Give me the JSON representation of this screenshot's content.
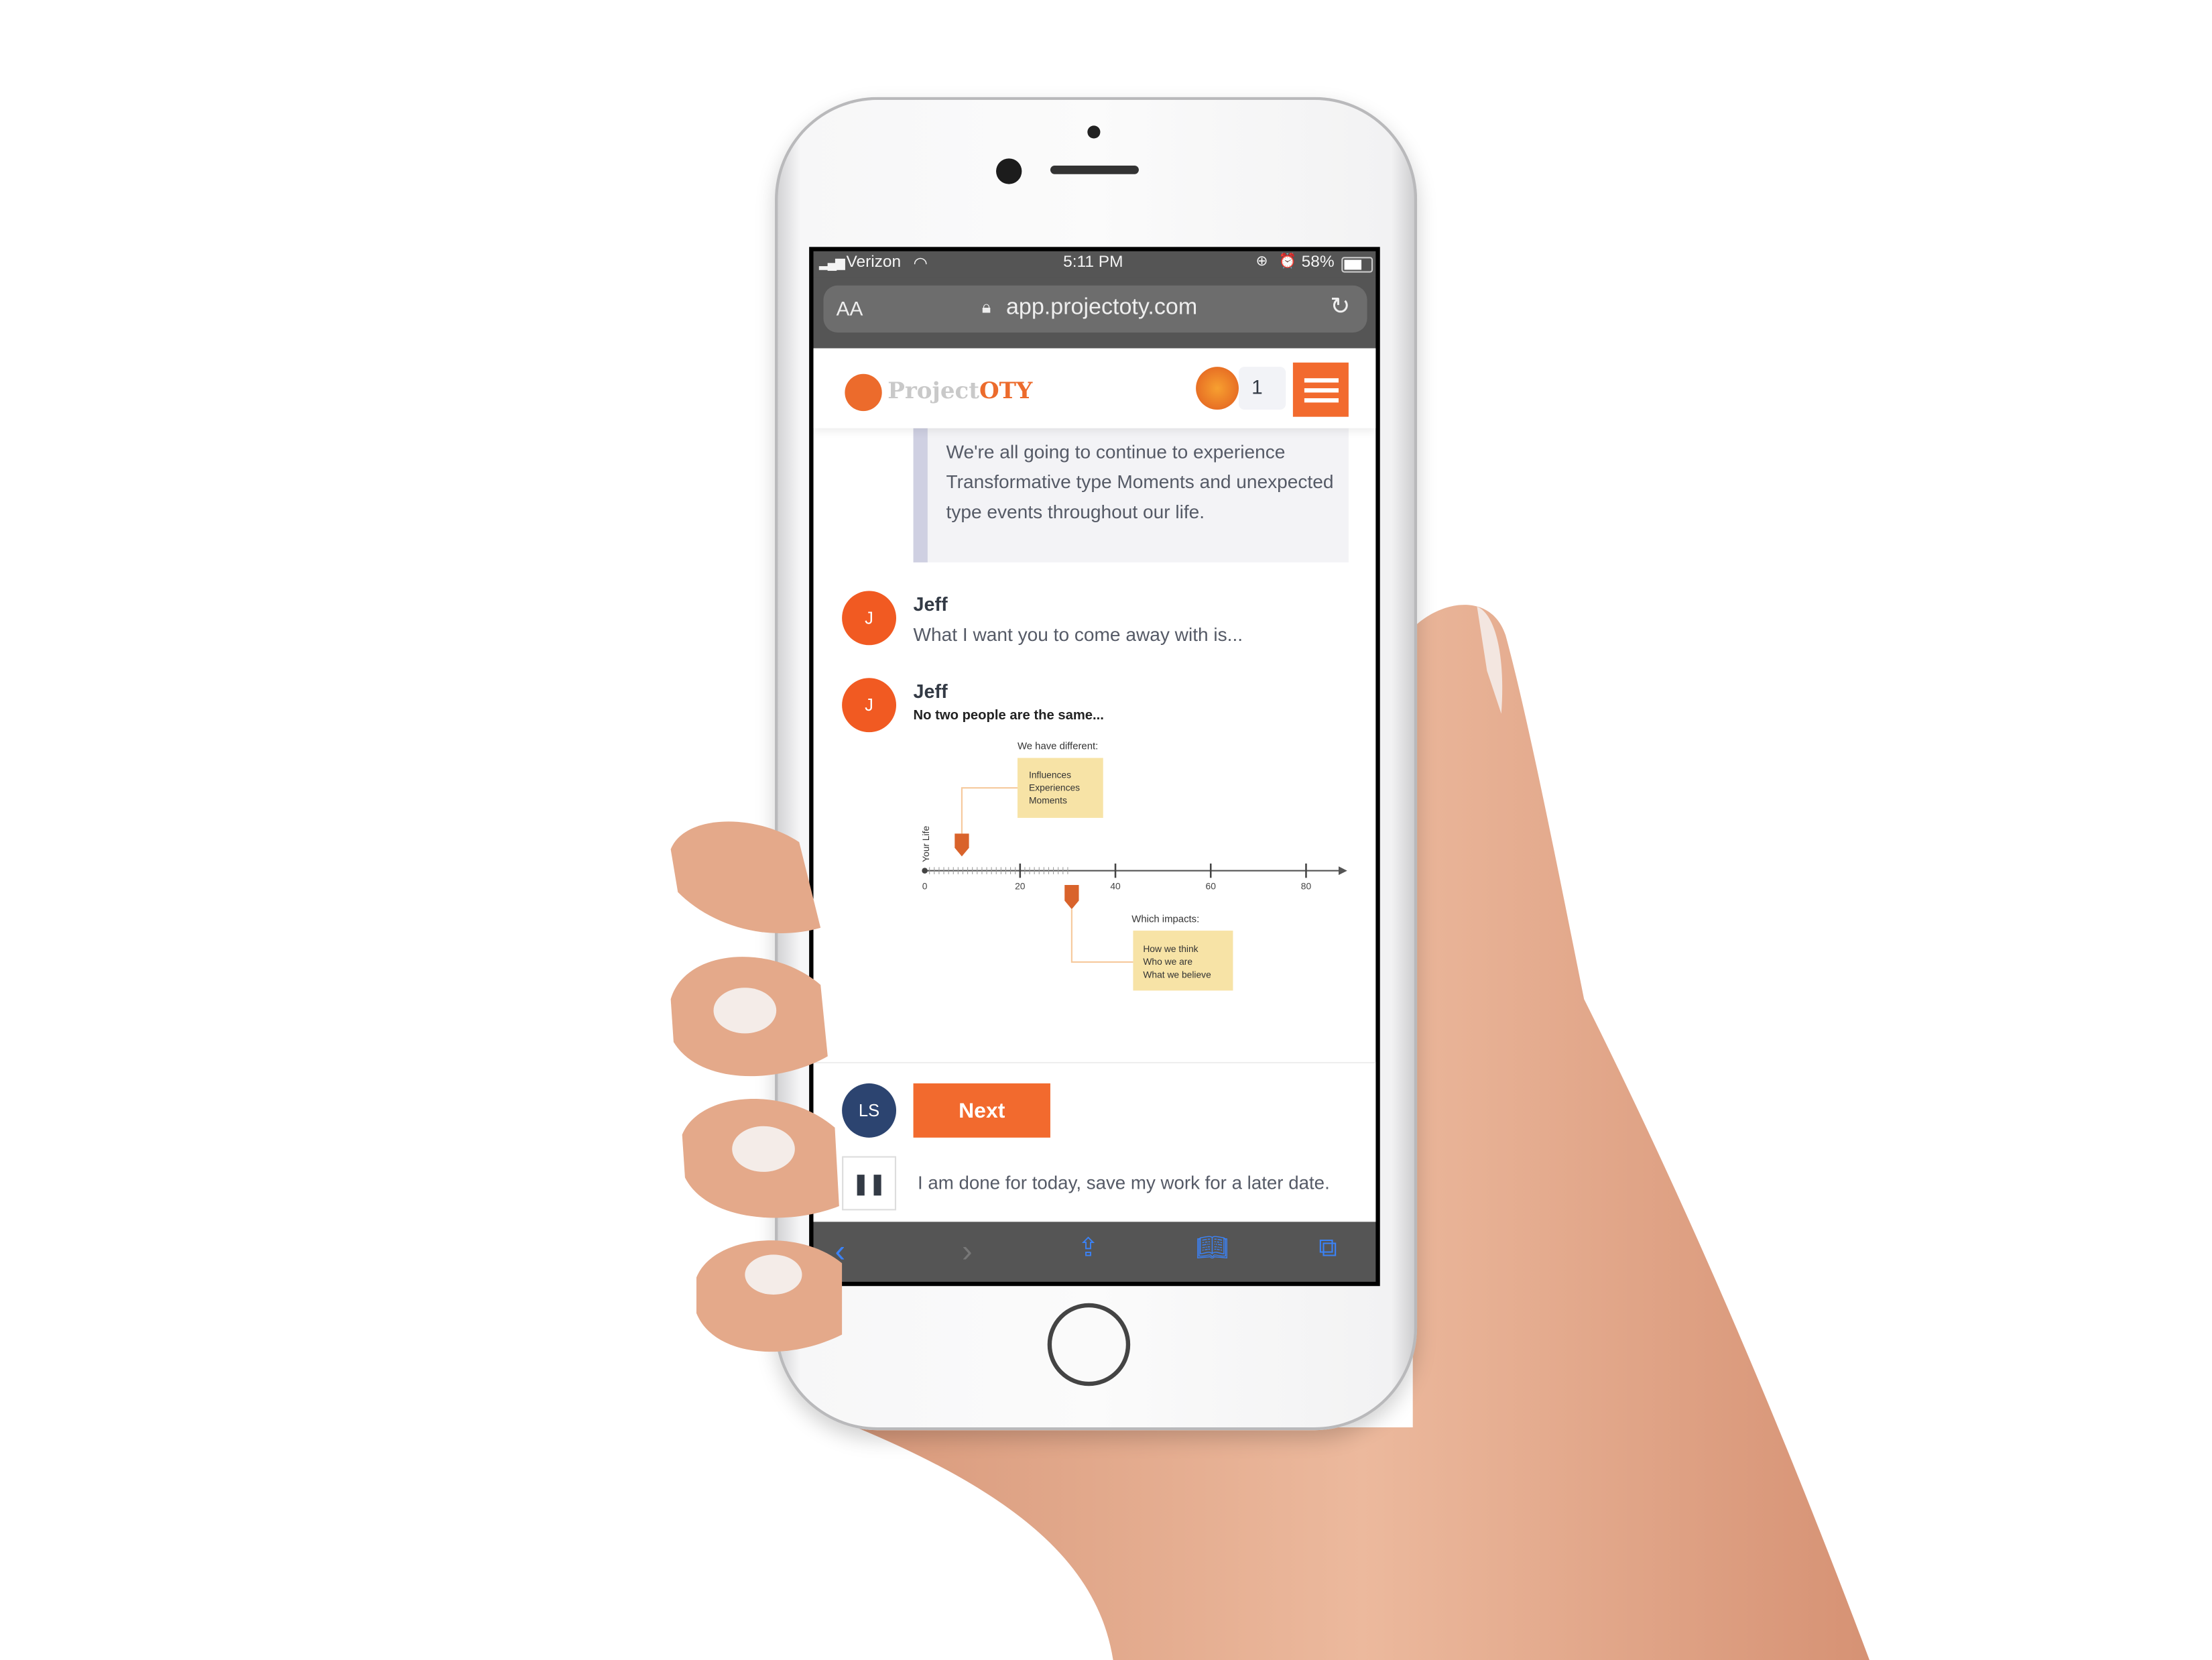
{
  "status_bar": {
    "carrier": "Verizon",
    "time": "5:11 PM",
    "battery": "58%",
    "battery_level": 0.58
  },
  "browser": {
    "text_size_label": "AA",
    "url": "app.projectoty.com"
  },
  "header": {
    "logo_part1": "Project",
    "logo_part2": "OTY",
    "notification_count": "1"
  },
  "conversation": {
    "quote": "We're all going to continue to experience Transformative type Moments and unexpected type events throughout our life.",
    "messages": [
      {
        "initial": "J",
        "author": "Jeff",
        "text": "What I want you to come away with is..."
      },
      {
        "initial": "J",
        "author": "Jeff",
        "text": "No two people are the same..."
      }
    ]
  },
  "diagram": {
    "top_caption": "We have different:",
    "top_box": [
      "Influences",
      "Experiences",
      "Moments"
    ],
    "axis_label": "Your Life",
    "ticks": [
      "0",
      "20",
      "40",
      "60",
      "80"
    ],
    "bottom_caption": "Which impacts:",
    "bottom_box": [
      "How we think",
      "Who we are",
      "What we believe"
    ],
    "accent": "#d9632b",
    "box_color": "#f7e3a6"
  },
  "footer": {
    "user_initials": "LS",
    "next_label": "Next",
    "pause_icon": "pause-icon",
    "save_text": "I am done for today, save my work for a later date."
  },
  "colors": {
    "brand": "#f26a2e",
    "avatar_user": "#2c4470"
  }
}
